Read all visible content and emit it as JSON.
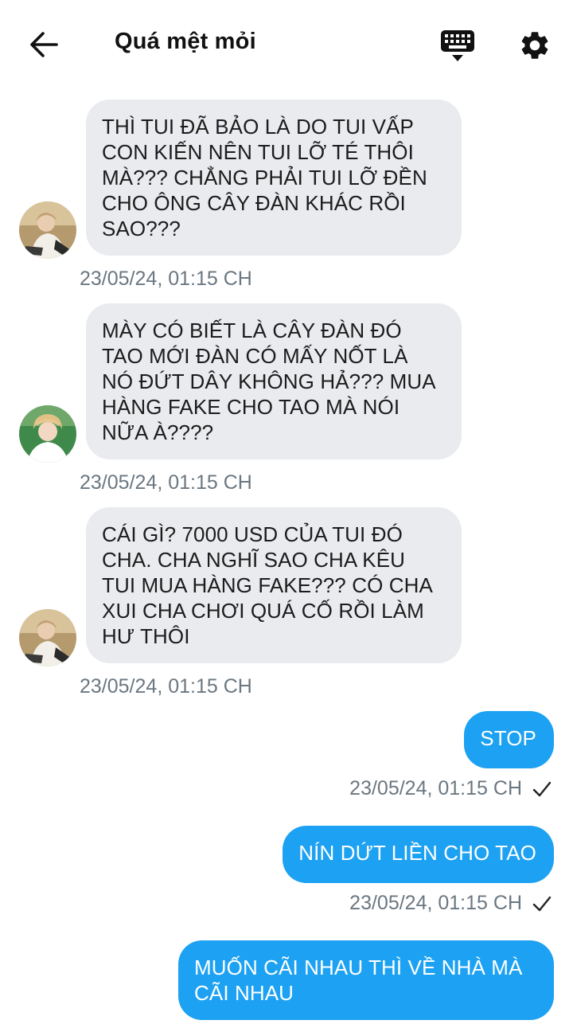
{
  "header": {
    "title": "Quá mệt mỏi",
    "back_icon": "arrow-left-icon",
    "keyboard_icon": "keyboard-icon",
    "settings_icon": "gear-icon"
  },
  "messages": [
    {
      "direction": "incoming",
      "text": "THÌ TUI ĐÃ BẢO LÀ DO TUI VẤP CON KIẾN NÊN TUI LỠ TÉ THÔI MÀ??? CHẲNG PHẢI TUI LỠ ĐỀN CHO ÔNG CÂY ĐÀN KHÁC RỒI SAO???",
      "time": "23/05/24, 01:15 CH"
    },
    {
      "direction": "incoming",
      "text": "MÀY CÓ BIẾT LÀ CÂY ĐÀN ĐÓ TAO MỚI ĐÀN CÓ MẤY NỐT LÀ NÓ ĐỨT DÂY KHÔNG HẢ??? MUA HÀNG FAKE CHO TAO MÀ NÓI NỮA À????",
      "time": "23/05/24, 01:15 CH"
    },
    {
      "direction": "incoming",
      "text": "CÁI GÌ? 7000 USD CỦA TUI ĐÓ CHA. CHA NGHĨ SAO CHA KÊU TUI MUA HÀNG FAKE??? CÓ CHA XUI CHA CHƠI QUÁ CỐ RỒI LÀM HƯ THÔI",
      "time": "23/05/24, 01:15 CH"
    },
    {
      "direction": "outgoing",
      "text": "STOP",
      "time": "23/05/24, 01:15 CH"
    },
    {
      "direction": "outgoing",
      "text": "NÍN DỨT LIỀN CHO TAO",
      "time": "23/05/24, 01:15 CH"
    },
    {
      "direction": "outgoing",
      "text": "MUỐN CÃI NHAU THÌ VỀ NHÀ MÀ CÃI NHAU",
      "time": ""
    }
  ],
  "colors": {
    "outgoing_bubble": "#1da1f2",
    "incoming_bubble": "#e9ebee",
    "timestamp": "#6b7781"
  }
}
